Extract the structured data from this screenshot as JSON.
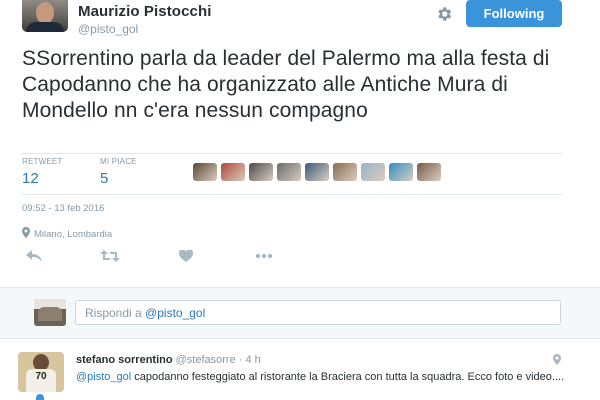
{
  "tweet": {
    "author_name": "Maurizio Pistocchi",
    "author_handle": "@pisto_gol",
    "follow_label": "Following",
    "text": "SSorrentino parla da leader del Palermo ma alla festa di Capodanno che ha organizzato alle Antiche Mura di Mondello nn c'era nessun compagno",
    "retweets_label": "RETWEET",
    "retweets_count": "12",
    "likes_label": "MI PIACE",
    "likes_count": "5",
    "timestamp": "09:52 - 13 feb 2016",
    "location": "Milano, Lombardia",
    "icons": [
      "gear-icon",
      "reply-icon",
      "retweet-icon",
      "heart-icon",
      "more-icon",
      "location-pin-icon"
    ]
  },
  "likers": [
    {
      "name": "liker-avatar-1",
      "color": "#5a4636"
    },
    {
      "name": "liker-avatar-2",
      "color": "#b0493a"
    },
    {
      "name": "liker-avatar-3",
      "color": "#4a4a4a"
    },
    {
      "name": "liker-avatar-4",
      "color": "#6a6a6a"
    },
    {
      "name": "liker-avatar-5",
      "color": "#3c5a7a"
    },
    {
      "name": "liker-avatar-6",
      "color": "#8a6b4e"
    },
    {
      "name": "liker-avatar-7",
      "color": "#9bb2c4"
    },
    {
      "name": "liker-avatar-8",
      "color": "#2f8fc4"
    },
    {
      "name": "liker-avatar-9",
      "color": "#7a5a46"
    }
  ],
  "reply_box": {
    "prefix": "Rispondi a ",
    "mention": "@pisto_gol"
  },
  "reply": {
    "author_name": "stefano sorrentino",
    "author_handle": "@stefasorre",
    "time": "· 4 h",
    "avatar_number": "70",
    "mention": "@pisto_gol",
    "text": " capodanno festeggiato al ristorante la Braciera con tutta la squadra. Ecco foto e video...."
  },
  "colors": {
    "accent": "#3b94d9",
    "link": "#2b7bb9",
    "muted": "#8899a6",
    "text": "#292f33"
  }
}
